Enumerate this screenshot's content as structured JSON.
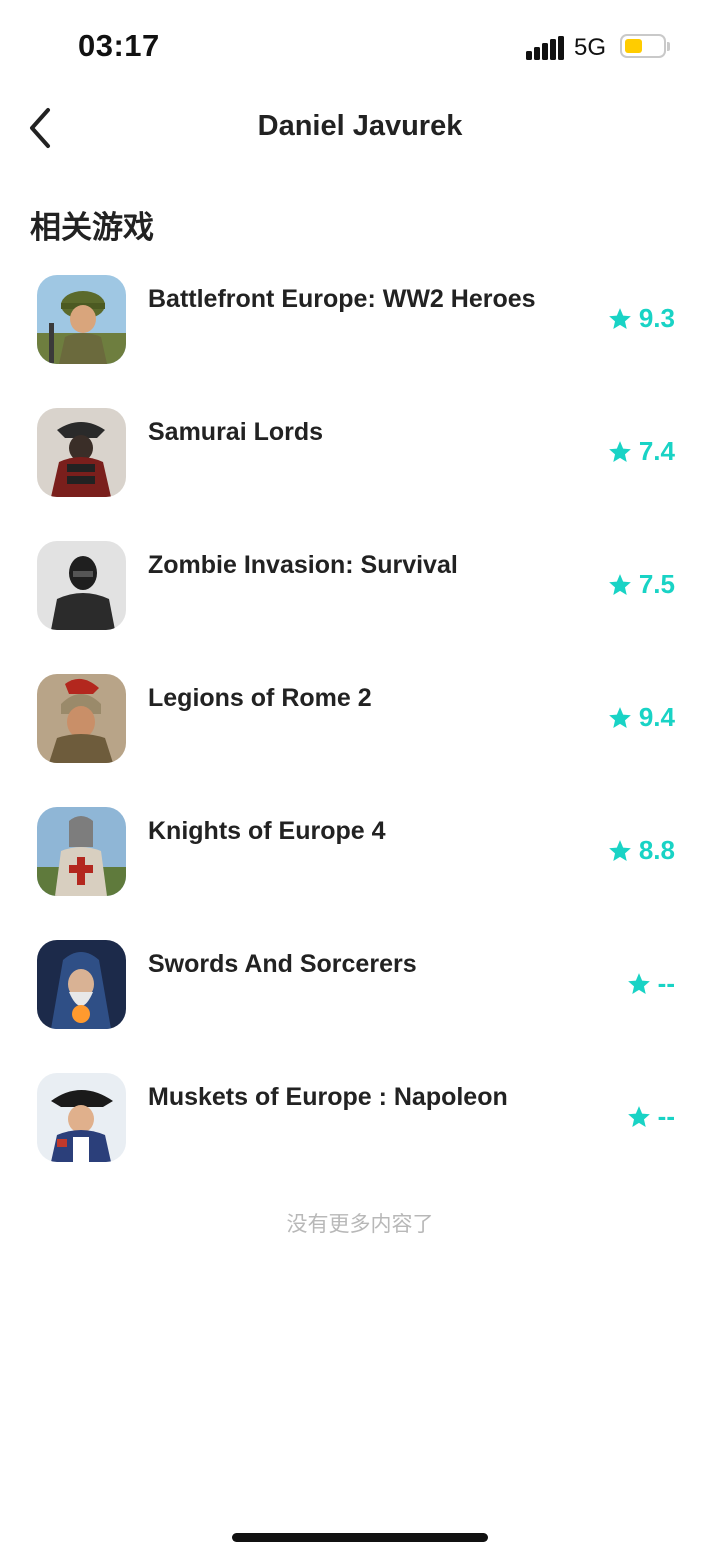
{
  "status": {
    "time": "03:17",
    "network": "5G",
    "signal_icon": "signal-bars-icon",
    "battery_icon": "battery-icon"
  },
  "nav": {
    "title": "Daniel Javurek",
    "back_icon": "chevron-left-icon"
  },
  "section": {
    "title": "相关游戏"
  },
  "colors": {
    "accent": "#19d3c5",
    "battery": "#ffcc00",
    "muted": "#b8b8b8"
  },
  "games": [
    {
      "name": "Battlefront Europe: WW2 Heroes",
      "rating": "9.3",
      "icon": "soldier-icon"
    },
    {
      "name": "Samurai Lords",
      "rating": "7.4",
      "icon": "samurai-icon"
    },
    {
      "name": "Zombie Invasion: Survival",
      "rating": "7.5",
      "icon": "zombie-survivor-icon"
    },
    {
      "name": "Legions of Rome 2",
      "rating": "9.4",
      "icon": "roman-legionary-icon"
    },
    {
      "name": "Knights of Europe 4",
      "rating": "8.8",
      "icon": "knight-icon"
    },
    {
      "name": "Swords And Sorcerers",
      "rating": "--",
      "icon": "wizard-icon"
    },
    {
      "name": "Muskets of Europe : Napoleon",
      "rating": "--",
      "icon": "napoleon-icon"
    }
  ],
  "footer": {
    "end_text": "没有更多内容了"
  }
}
